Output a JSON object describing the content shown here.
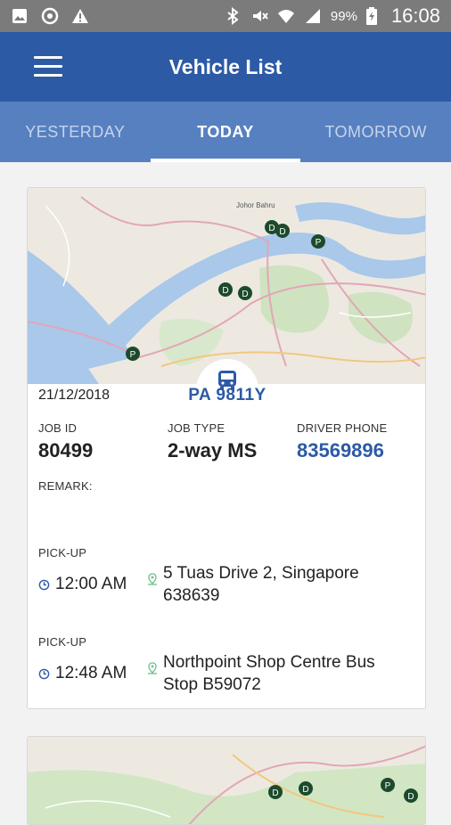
{
  "status_bar": {
    "battery": "99%",
    "time": "16:08",
    "icons": [
      "gallery-icon",
      "sync-icon",
      "warning-icon",
      "bluetooth-icon",
      "mute-icon",
      "wifi-icon",
      "signal-icon",
      "battery-icon"
    ]
  },
  "app_bar": {
    "title": "Vehicle List",
    "menu_icon": "hamburger-icon"
  },
  "tabs": [
    {
      "label": "YESTERDAY",
      "active": false
    },
    {
      "label": "TODAY",
      "active": true
    },
    {
      "label": "TOMORROW",
      "active": false
    }
  ],
  "colors": {
    "primary": "#2c5aa5",
    "tabs_bg": "#5780c0",
    "status_bar": "#7b7b7b"
  },
  "card": {
    "date": "21/12/2018",
    "plate": "PA 9811Y",
    "job_id_label": "JOB ID",
    "job_id": "80499",
    "job_type_label": "JOB TYPE",
    "job_type": "2-way MS",
    "driver_phone_label": "DRIVER PHONE",
    "driver_phone": "83569896",
    "remark_label": "REMARK:",
    "remark": "",
    "pickups": [
      {
        "label": "PICK-UP",
        "time": "12:00 AM",
        "address_line1": "5 Tuas Drive 2, Singapore",
        "address_line2": "638639"
      },
      {
        "label": "PICK-UP",
        "time": "12:48 AM",
        "address_line1": "Northpoint Shop Centre Bus",
        "address_line2": "Stop B59072"
      }
    ]
  },
  "map_labels": {
    "city": "Johor Bahru",
    "marker_d": "D",
    "marker_p": "P"
  }
}
